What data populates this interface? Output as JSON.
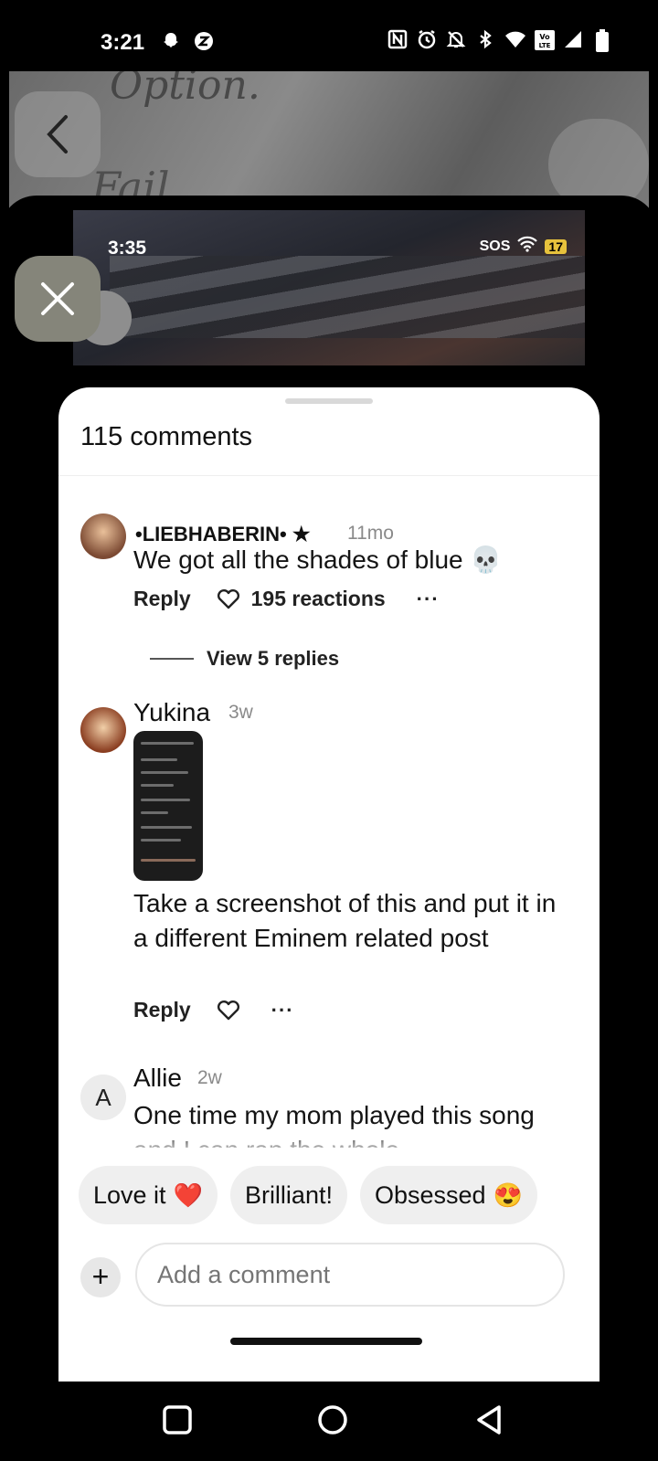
{
  "status_bar": {
    "time": "3:21",
    "left_icons": [
      "snapchat-icon",
      "app-z-icon"
    ],
    "right_icons": [
      "nfc-icon",
      "alarm-icon",
      "mute-icon",
      "bluetooth-icon",
      "wifi-icon",
      "volte-icon",
      "signal-icon",
      "battery-icon"
    ]
  },
  "inner_screenshot": {
    "time": "3:35",
    "sos": "SOS",
    "battery": "17"
  },
  "comments": {
    "title": "115 comments",
    "items": [
      {
        "name": "•LIEBHABERIN• ★",
        "time": "11mo",
        "text": "We got all the shades of blue 💀",
        "reply": "Reply",
        "reactions": "195 reactions",
        "more": "···",
        "view_replies": "View 5 replies"
      },
      {
        "name": "Yukina",
        "time": "3w",
        "text": "Take a screenshot of this and put it in a different Eminem related post",
        "reply": "Reply",
        "more": "···"
      },
      {
        "avatar_letter": "A",
        "name": "Allie",
        "time": "2w",
        "text": "One time my mom played this song and I can rap the whole"
      }
    ]
  },
  "quick_reactions": [
    {
      "label": "Love it",
      "emoji": "❤️"
    },
    {
      "label": "Brilliant!",
      "emoji": ""
    },
    {
      "label": "Obsessed",
      "emoji": "😍"
    }
  ],
  "composer": {
    "plus": "+",
    "placeholder": "Add a comment"
  }
}
